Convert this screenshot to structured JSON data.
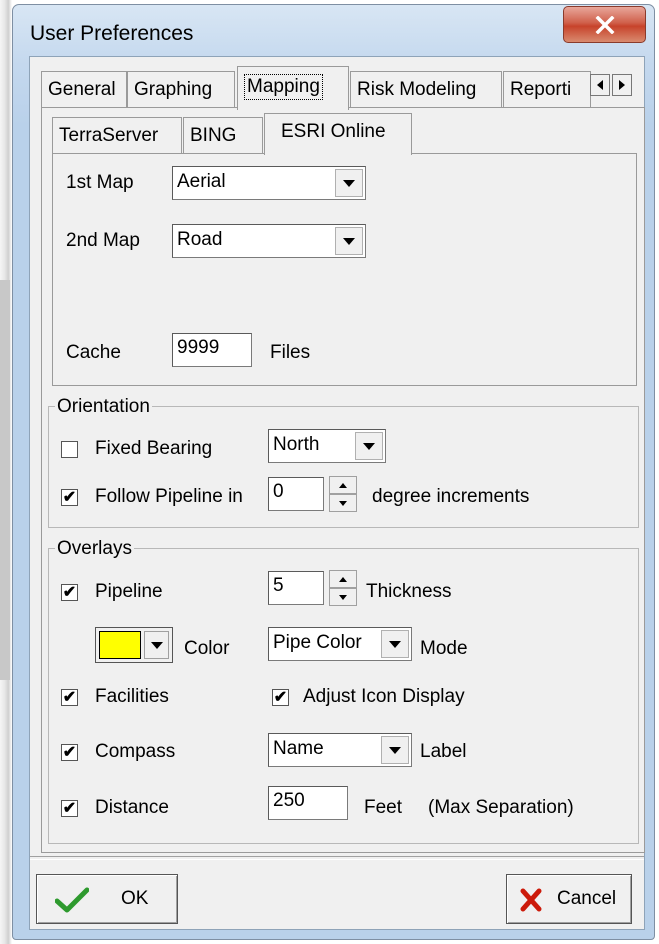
{
  "window": {
    "title": "User Preferences"
  },
  "tabs": {
    "main": [
      "General",
      "Graphing",
      "Mapping",
      "Risk Modeling",
      "Reporti"
    ],
    "selected_main": "Mapping",
    "sub": [
      "TerraServer",
      "BING",
      "ESRI Online"
    ],
    "selected_sub": "ESRI Online"
  },
  "map_settings": {
    "first_map_label": "1st Map",
    "first_map_value": "Aerial",
    "second_map_label": "2nd Map",
    "second_map_value": "Road",
    "cache_label": "Cache",
    "cache_value": "9999",
    "cache_units": "Files"
  },
  "orientation": {
    "group_title": "Orientation",
    "fixed_bearing_label": "Fixed Bearing",
    "fixed_bearing_checked": false,
    "bearing_value": "North",
    "follow_pipeline_label": "Follow Pipeline in",
    "follow_pipeline_checked": true,
    "increment_value": "0",
    "increment_units": "degree increments"
  },
  "overlays": {
    "group_title": "Overlays",
    "pipeline_label": "Pipeline",
    "pipeline_checked": true,
    "thickness_value": "5",
    "thickness_label": "Thickness",
    "color_label": "Color",
    "color_swatch": "#ffff00",
    "mode_value": "Pipe Color",
    "mode_label": "Mode",
    "facilities_label": "Facilities",
    "facilities_checked": true,
    "adjust_icon_label": "Adjust Icon Display",
    "adjust_icon_checked": true,
    "compass_label": "Compass",
    "compass_checked": true,
    "label_value": "Name",
    "label_label": "Label",
    "distance_label": "Distance",
    "distance_checked": true,
    "distance_value": "250",
    "distance_units": "Feet",
    "distance_note": "(Max Separation)"
  },
  "buttons": {
    "ok_label": "OK",
    "cancel_label": "Cancel"
  },
  "colors": {
    "ok_check": "#2e9a2e",
    "cancel_x": "#cc1a0a",
    "close_button": "#c7432b"
  }
}
